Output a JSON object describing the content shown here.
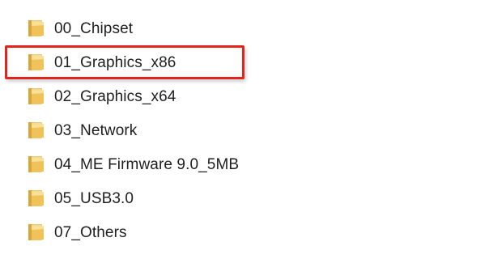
{
  "folders": [
    {
      "label": "00_Chipset",
      "icon": "folder-icon"
    },
    {
      "label": "01_Graphics_x86",
      "icon": "folder-icon"
    },
    {
      "label": "02_Graphics_x64",
      "icon": "folder-icon"
    },
    {
      "label": "03_Network",
      "icon": "folder-icon"
    },
    {
      "label": "04_ME Firmware 9.0_5MB",
      "icon": "folder-icon"
    },
    {
      "label": "05_USB3.0",
      "icon": "folder-icon"
    },
    {
      "label": "07_Others",
      "icon": "folder-icon"
    }
  ],
  "highlight": {
    "target_index": 1,
    "color": "#e1251b"
  },
  "colors": {
    "folder_light": "#f7dd8a",
    "folder_mid": "#efc35a",
    "folder_dark": "#d9a63a",
    "folder_back": "#e7c878",
    "text": "#1f1f1f"
  }
}
